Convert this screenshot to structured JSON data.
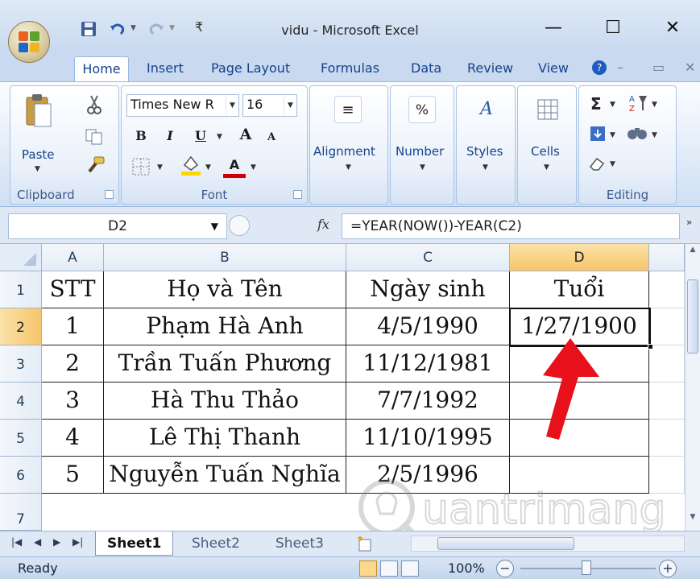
{
  "window": {
    "title": "vidu - Microsoft Excel",
    "controls": {
      "minimize": "—",
      "maximize": "☐",
      "close": "✕"
    }
  },
  "quick_access": {
    "customize_glyph": "₹"
  },
  "tabs": [
    {
      "label": "Home",
      "active": true
    },
    {
      "label": "Insert"
    },
    {
      "label": "Page Layout"
    },
    {
      "label": "Formulas"
    },
    {
      "label": "Data"
    },
    {
      "label": "Review"
    },
    {
      "label": "View"
    }
  ],
  "ribbon": {
    "clipboard": {
      "label": "Clipboard",
      "paste": "Paste"
    },
    "font": {
      "label": "Font",
      "font_name": "Times New R",
      "font_size": "16",
      "bold": "B",
      "italic": "I",
      "underline": "U",
      "grow": "A",
      "shrink": "A",
      "font_color": "#d00000",
      "fill_color": "#ffd700"
    },
    "alignment": {
      "label": "Alignment"
    },
    "number": {
      "label": "Number",
      "glyph": "%"
    },
    "styles": {
      "label": "Styles"
    },
    "cells": {
      "label": "Cells"
    },
    "editing": {
      "label": "Editing",
      "sum_glyph": "Σ"
    }
  },
  "formula_bar": {
    "name_box": "D2",
    "fx": "fx",
    "formula": "=YEAR(NOW())-YEAR(C2)"
  },
  "grid": {
    "columns": [
      "A",
      "B",
      "C",
      "D"
    ],
    "selected_column": "D",
    "rows": [
      "1",
      "2",
      "3",
      "4",
      "5",
      "6",
      "7"
    ],
    "selected_row": "2",
    "cells": [
      [
        "STT",
        "Họ và Tên",
        "Ngày sinh",
        "Tuổi"
      ],
      [
        "1",
        "Phạm Hà Anh",
        "4/5/1990",
        "1/27/1900"
      ],
      [
        "2",
        "Trần Tuấn Phương",
        "11/12/1981",
        ""
      ],
      [
        "3",
        "Hà Thu Thảo",
        "7/7/1992",
        ""
      ],
      [
        "4",
        "Lê Thị Thanh",
        "11/10/1995",
        ""
      ],
      [
        "5",
        "Nguyễn Tuấn Nghĩa",
        "2/5/1996",
        ""
      ]
    ]
  },
  "annotation": {
    "arrow_color": "#e8101a"
  },
  "watermark": {
    "text": "uantrimang"
  },
  "sheets": [
    {
      "label": "Sheet1",
      "active": true
    },
    {
      "label": "Sheet2"
    },
    {
      "label": "Sheet3"
    }
  ],
  "status_bar": {
    "status": "Ready",
    "zoom": "100%",
    "zoom_out": "−",
    "zoom_in": "+"
  }
}
